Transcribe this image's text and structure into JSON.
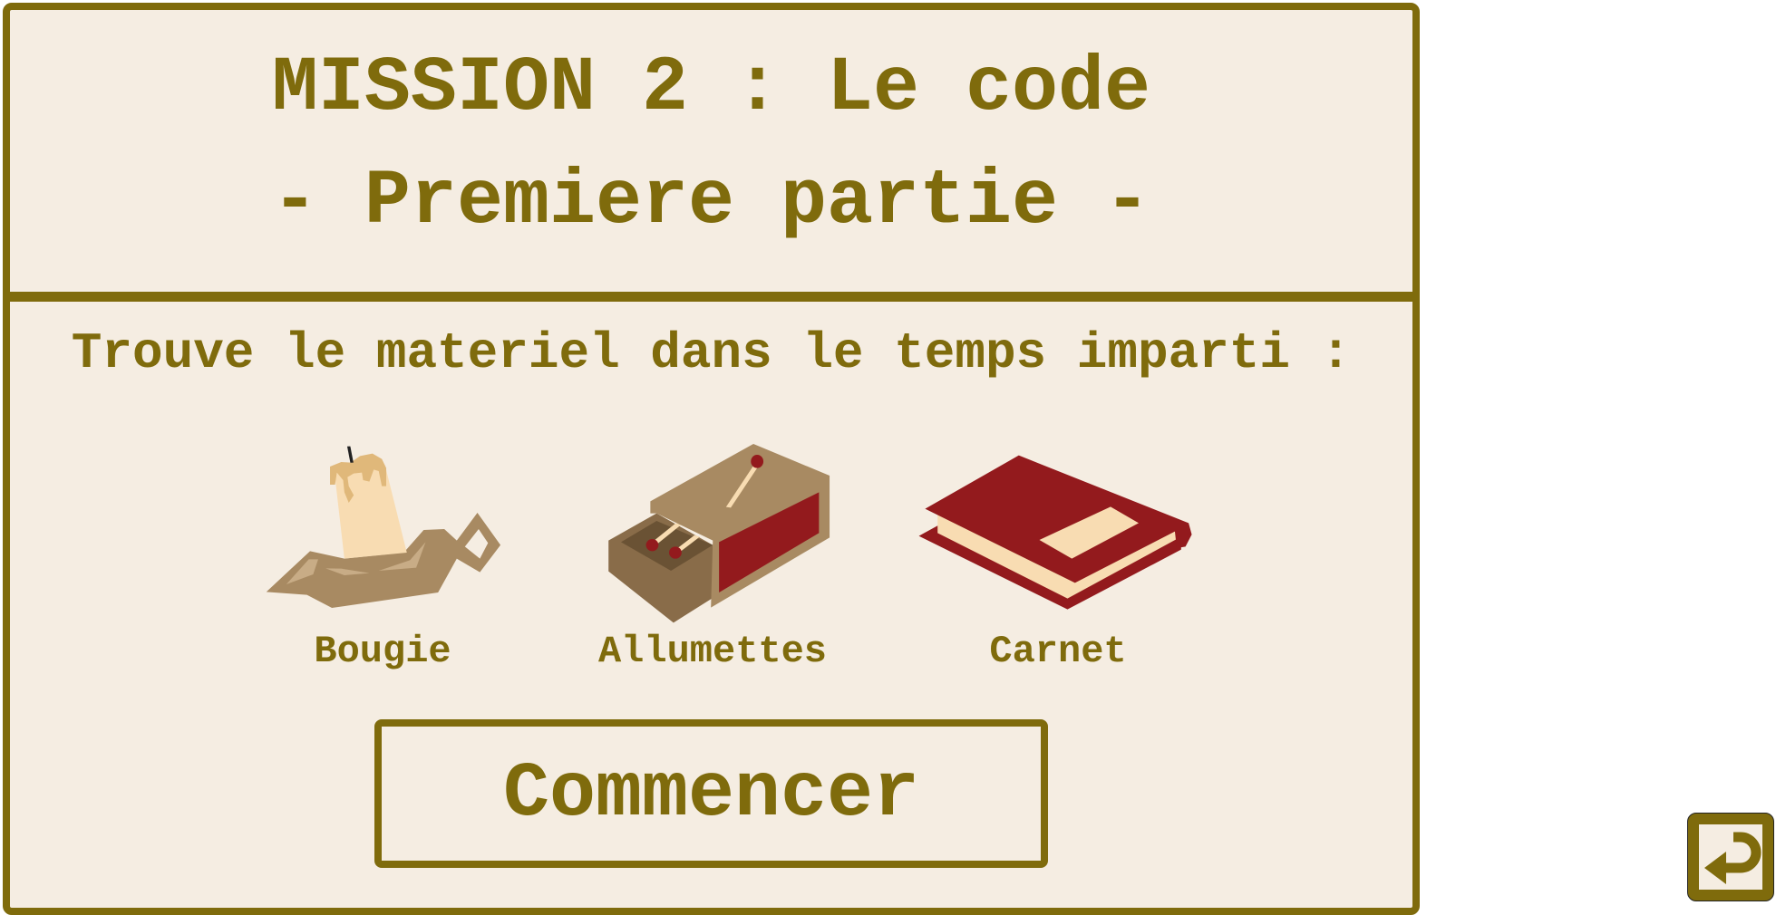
{
  "title": {
    "line1": "MISSION 2 : Le code",
    "line2": "- Premiere partie -"
  },
  "instruction": "Trouve le materiel dans le temps imparti :",
  "items": [
    {
      "label": "Bougie",
      "icon": "candle-icon"
    },
    {
      "label": "Allumettes",
      "icon": "matchbox-icon"
    },
    {
      "label": "Carnet",
      "icon": "notebook-icon"
    }
  ],
  "start_button": "Commencer",
  "back_button": {
    "icon": "return-arrow-icon"
  },
  "colors": {
    "accent": "#7f6b0c",
    "background": "#f5ede2",
    "red": "#931a1d",
    "tan": "#a88a62",
    "cream": "#f8dcb2"
  }
}
